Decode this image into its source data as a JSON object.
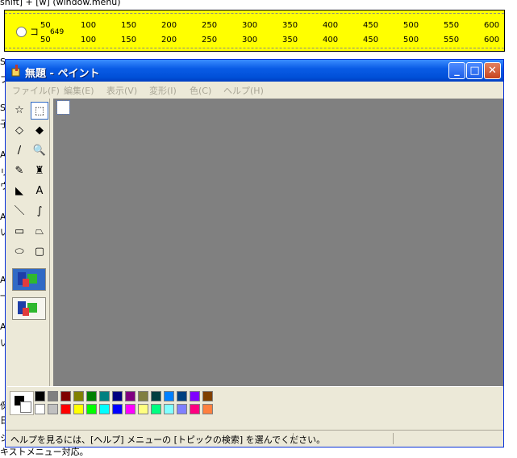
{
  "background": {
    "top_text": "shift] + [w] (window.menu)",
    "bottom_text": "キストメニュー対応。",
    "left_fragments": [
      "S",
      "プ",
      "S",
      "子",
      "A",
      "リ",
      "ウ",
      "A",
      "い",
      "A",
      "一",
      "A",
      "い",
      "保",
      "日",
      "シ"
    ]
  },
  "ruler": {
    "color": "#ffff00",
    "label": "コ",
    "value": "649",
    "ticks": [
      "50",
      "100",
      "150",
      "200",
      "250",
      "300",
      "350",
      "400",
      "450",
      "500",
      "550",
      "600"
    ]
  },
  "window": {
    "title": "無題 - ペイント",
    "controls": {
      "minimize": "_",
      "maximize": "□",
      "close": "✕"
    },
    "menu": [
      "ファイル(F)",
      "編集(E)",
      "表示(V)",
      "変形(I)",
      "色(C)",
      "ヘルプ(H)"
    ],
    "status_text": "ヘルプを見るには、[ヘルプ] メニューの [トピックの検索] を選んでください。"
  },
  "tools": [
    {
      "name": "free-select",
      "glyph": "☆"
    },
    {
      "name": "rect-select",
      "glyph": "⬚"
    },
    {
      "name": "eraser",
      "glyph": "◇"
    },
    {
      "name": "fill",
      "glyph": "◆"
    },
    {
      "name": "color-picker",
      "glyph": "/"
    },
    {
      "name": "magnifier",
      "glyph": "🔍"
    },
    {
      "name": "pencil",
      "glyph": "✎"
    },
    {
      "name": "brush",
      "glyph": "♜"
    },
    {
      "name": "airbrush",
      "glyph": "◣"
    },
    {
      "name": "text",
      "glyph": "A"
    },
    {
      "name": "line",
      "glyph": "＼"
    },
    {
      "name": "curve",
      "glyph": "∫"
    },
    {
      "name": "rectangle",
      "glyph": "▭"
    },
    {
      "name": "polygon",
      "glyph": "⏢"
    },
    {
      "name": "ellipse",
      "glyph": "⬭"
    },
    {
      "name": "rounded-rectangle",
      "glyph": "▢"
    }
  ],
  "palette_colors": {
    "top": [
      "#000000",
      "#808080",
      "#800000",
      "#808000",
      "#008000",
      "#008080",
      "#000080",
      "#800080",
      "#808040",
      "#004040",
      "#0080ff",
      "#004080",
      "#8000ff",
      "#804000"
    ],
    "bottom": [
      "#ffffff",
      "#c0c0c0",
      "#ff0000",
      "#ffff00",
      "#00ff00",
      "#00ffff",
      "#0000ff",
      "#ff00ff",
      "#ffff80",
      "#00ff80",
      "#80ffff",
      "#8080ff",
      "#ff0080",
      "#ff8040"
    ]
  }
}
